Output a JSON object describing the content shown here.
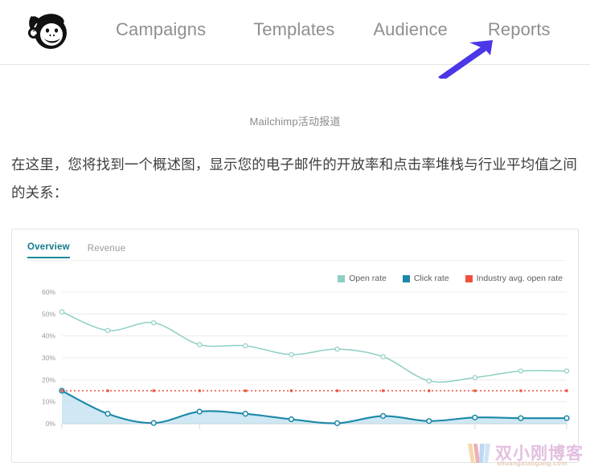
{
  "nav": {
    "logo_name": "mailchimp-freddie-logo",
    "links": [
      {
        "label": "Campaigns"
      },
      {
        "label": "Templates"
      },
      {
        "label": "Audience"
      },
      {
        "label": "Reports"
      }
    ]
  },
  "annotation": {
    "name": "purple-arrow-pointing-to-reports",
    "color": "#4b36e8"
  },
  "caption": {
    "text": "Mailchimp活动报道"
  },
  "body": {
    "paragraph": "在这里，您将找到一个概述图，显示您的电子邮件的开放率和点击率堆栈与行业平均值之间的关系："
  },
  "chart_card": {
    "tabs": [
      {
        "label": "Overview",
        "active": true
      },
      {
        "label": "Revenue",
        "active": false
      }
    ],
    "legend": [
      {
        "label": "Open rate",
        "color": "#8ecfc4"
      },
      {
        "label": "Click rate",
        "color": "#1b88a8"
      },
      {
        "label": "Industry avg. open rate",
        "color": "#f0503c"
      }
    ]
  },
  "chart_data": {
    "type": "line",
    "title": "",
    "xlabel": "",
    "ylabel": "",
    "ylim": [
      0,
      60
    ],
    "ytick_labels": [
      "60%",
      "50%",
      "40%",
      "30%",
      "20%",
      "10%",
      "0%"
    ],
    "ytick_values": [
      60,
      50,
      40,
      30,
      20,
      10,
      0
    ],
    "grid": true,
    "legend_position": "top-right",
    "x": [
      1,
      2,
      3,
      4,
      5,
      6,
      7,
      8,
      9,
      10,
      11,
      12
    ],
    "xtick_labels": [],
    "series": [
      {
        "name": "Open rate",
        "color": "#8ecfc4",
        "values": [
          51.0,
          42.5,
          46.0,
          36.0,
          35.5,
          31.5,
          34.0,
          30.5,
          19.5,
          21.0,
          24.0,
          24.0
        ],
        "style": "line-markers"
      },
      {
        "name": "Click rate",
        "color": "#1b88a8",
        "values": [
          15.0,
          4.5,
          0.3,
          5.5,
          4.5,
          2.0,
          0.2,
          3.5,
          1.2,
          2.8,
          2.5,
          2.5
        ],
        "style": "area-markers",
        "fill": "#bfe0ef"
      },
      {
        "name": "Industry avg. open rate",
        "color": "#f0503c",
        "constant": 15.0,
        "style": "dotted-horizontal"
      }
    ]
  },
  "watermark": {
    "title": "双小刚博客",
    "url": "shuangxiaogang.com"
  }
}
